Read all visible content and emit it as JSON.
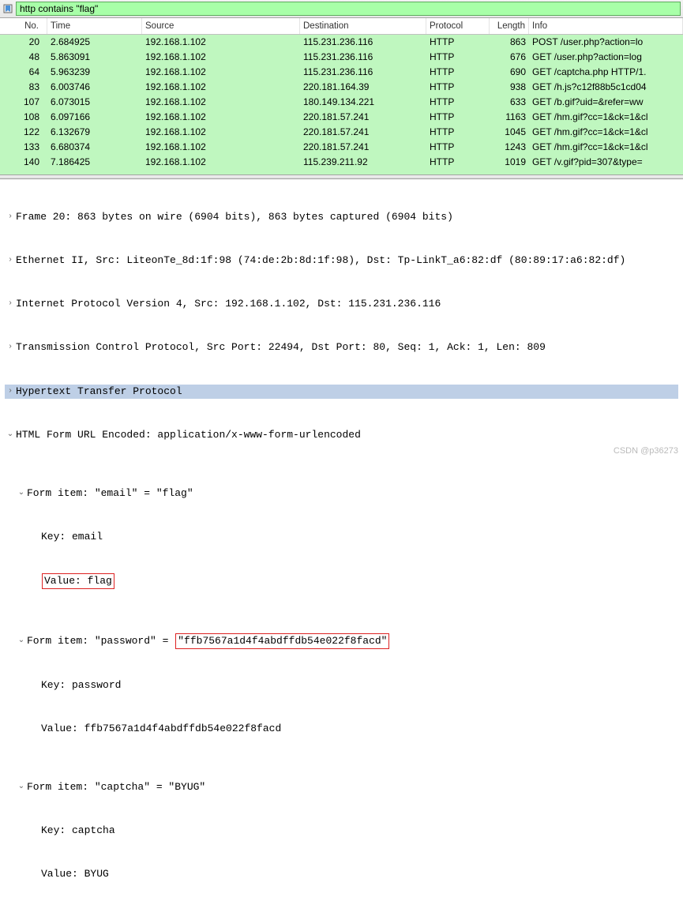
{
  "filter": {
    "text": "http contains \"flag\""
  },
  "columns": {
    "no": "No.",
    "time": "Time",
    "source": "Source",
    "destination": "Destination",
    "protocol": "Protocol",
    "length": "Length",
    "info": "Info"
  },
  "packets": [
    {
      "no": "20",
      "time": "2.684925",
      "src": "192.168.1.102",
      "dst": "115.231.236.116",
      "proto": "HTTP",
      "len": "863",
      "info": "POST /user.php?action=lo",
      "selected": true
    },
    {
      "no": "48",
      "time": "5.863091",
      "src": "192.168.1.102",
      "dst": "115.231.236.116",
      "proto": "HTTP",
      "len": "676",
      "info": "GET /user.php?action=log"
    },
    {
      "no": "64",
      "time": "5.963239",
      "src": "192.168.1.102",
      "dst": "115.231.236.116",
      "proto": "HTTP",
      "len": "690",
      "info": "GET /captcha.php HTTP/1."
    },
    {
      "no": "83",
      "time": "6.003746",
      "src": "192.168.1.102",
      "dst": "220.181.164.39",
      "proto": "HTTP",
      "len": "938",
      "info": "GET /h.js?c12f88b5c1cd04"
    },
    {
      "no": "107",
      "time": "6.073015",
      "src": "192.168.1.102",
      "dst": "180.149.134.221",
      "proto": "HTTP",
      "len": "633",
      "info": "GET /b.gif?uid=&refer=ww"
    },
    {
      "no": "108",
      "time": "6.097166",
      "src": "192.168.1.102",
      "dst": "220.181.57.241",
      "proto": "HTTP",
      "len": "1163",
      "info": "GET /hm.gif?cc=1&ck=1&cl"
    },
    {
      "no": "122",
      "time": "6.132679",
      "src": "192.168.1.102",
      "dst": "220.181.57.241",
      "proto": "HTTP",
      "len": "1045",
      "info": "GET /hm.gif?cc=1&ck=1&cl"
    },
    {
      "no": "133",
      "time": "6.680374",
      "src": "192.168.1.102",
      "dst": "220.181.57.241",
      "proto": "HTTP",
      "len": "1243",
      "info": "GET /hm.gif?cc=1&ck=1&cl"
    },
    {
      "no": "140",
      "time": "7.186425",
      "src": "192.168.1.102",
      "dst": "115.239.211.92",
      "proto": "HTTP",
      "len": "1019",
      "info": "GET /v.gif?pid=307&type="
    }
  ],
  "details": {
    "frame": "Frame 20: 863 bytes on wire (6904 bits), 863 bytes captured (6904 bits)",
    "eth": "Ethernet II, Src: LiteonTe_8d:1f:98 (74:de:2b:8d:1f:98), Dst: Tp-LinkT_a6:82:df (80:89:17:a6:82:df)",
    "ip": "Internet Protocol Version 4, Src: 192.168.1.102, Dst: 115.231.236.116",
    "tcp": "Transmission Control Protocol, Src Port: 22494, Dst Port: 80, Seq: 1, Ack: 1, Len: 809",
    "http": "Hypertext Transfer Protocol",
    "form": "HTML Form URL Encoded: application/x-www-form-urlencoded",
    "item1": "Form item: \"email\" = \"flag\"",
    "item1_key": "Key: email",
    "item1_value": "Value: flag",
    "item2_prefix": "Form item: \"password\" = ",
    "item2_box": "\"ffb7567a1d4f4abdffdb54e022f8facd\"",
    "item2_key": "Key: password",
    "item2_value": "Value: ffb7567a1d4f4abdffdb54e022f8facd",
    "item3": "Form item: \"captcha\" = \"BYUG\"",
    "item3_key": "Key: captcha",
    "item3_value": "Value: BYUG"
  },
  "watermark": "CSDN @p36273"
}
